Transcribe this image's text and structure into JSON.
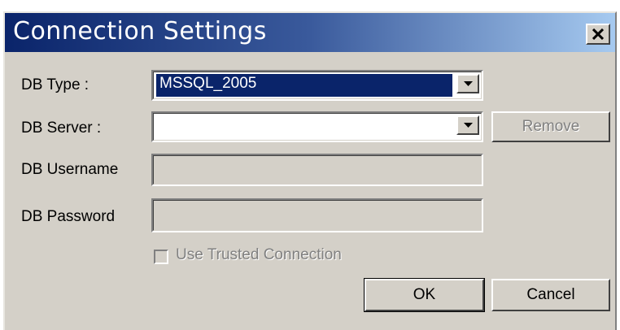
{
  "dialog": {
    "title": "Connection Settings",
    "close_icon": "close-icon"
  },
  "form": {
    "db_type_label": "DB Type :",
    "db_type_value": "MSSQL_2005",
    "db_server_label": "DB Server :",
    "db_server_value": "",
    "db_username_label": "DB Username",
    "db_username_value": "",
    "db_password_label": "DB Password",
    "db_password_value": "",
    "trusted_connection_label": "Use Trusted Connection",
    "trusted_connection_checked": false,
    "trusted_connection_enabled": false
  },
  "buttons": {
    "remove_label": "Remove",
    "remove_enabled": false,
    "ok_label": "OK",
    "cancel_label": "Cancel"
  },
  "colors": {
    "title_gradient_start": "#0a246a",
    "title_gradient_end": "#a6caf0",
    "face": "#d4d0c8",
    "selection": "#0a246a",
    "disabled_text": "#808080"
  }
}
